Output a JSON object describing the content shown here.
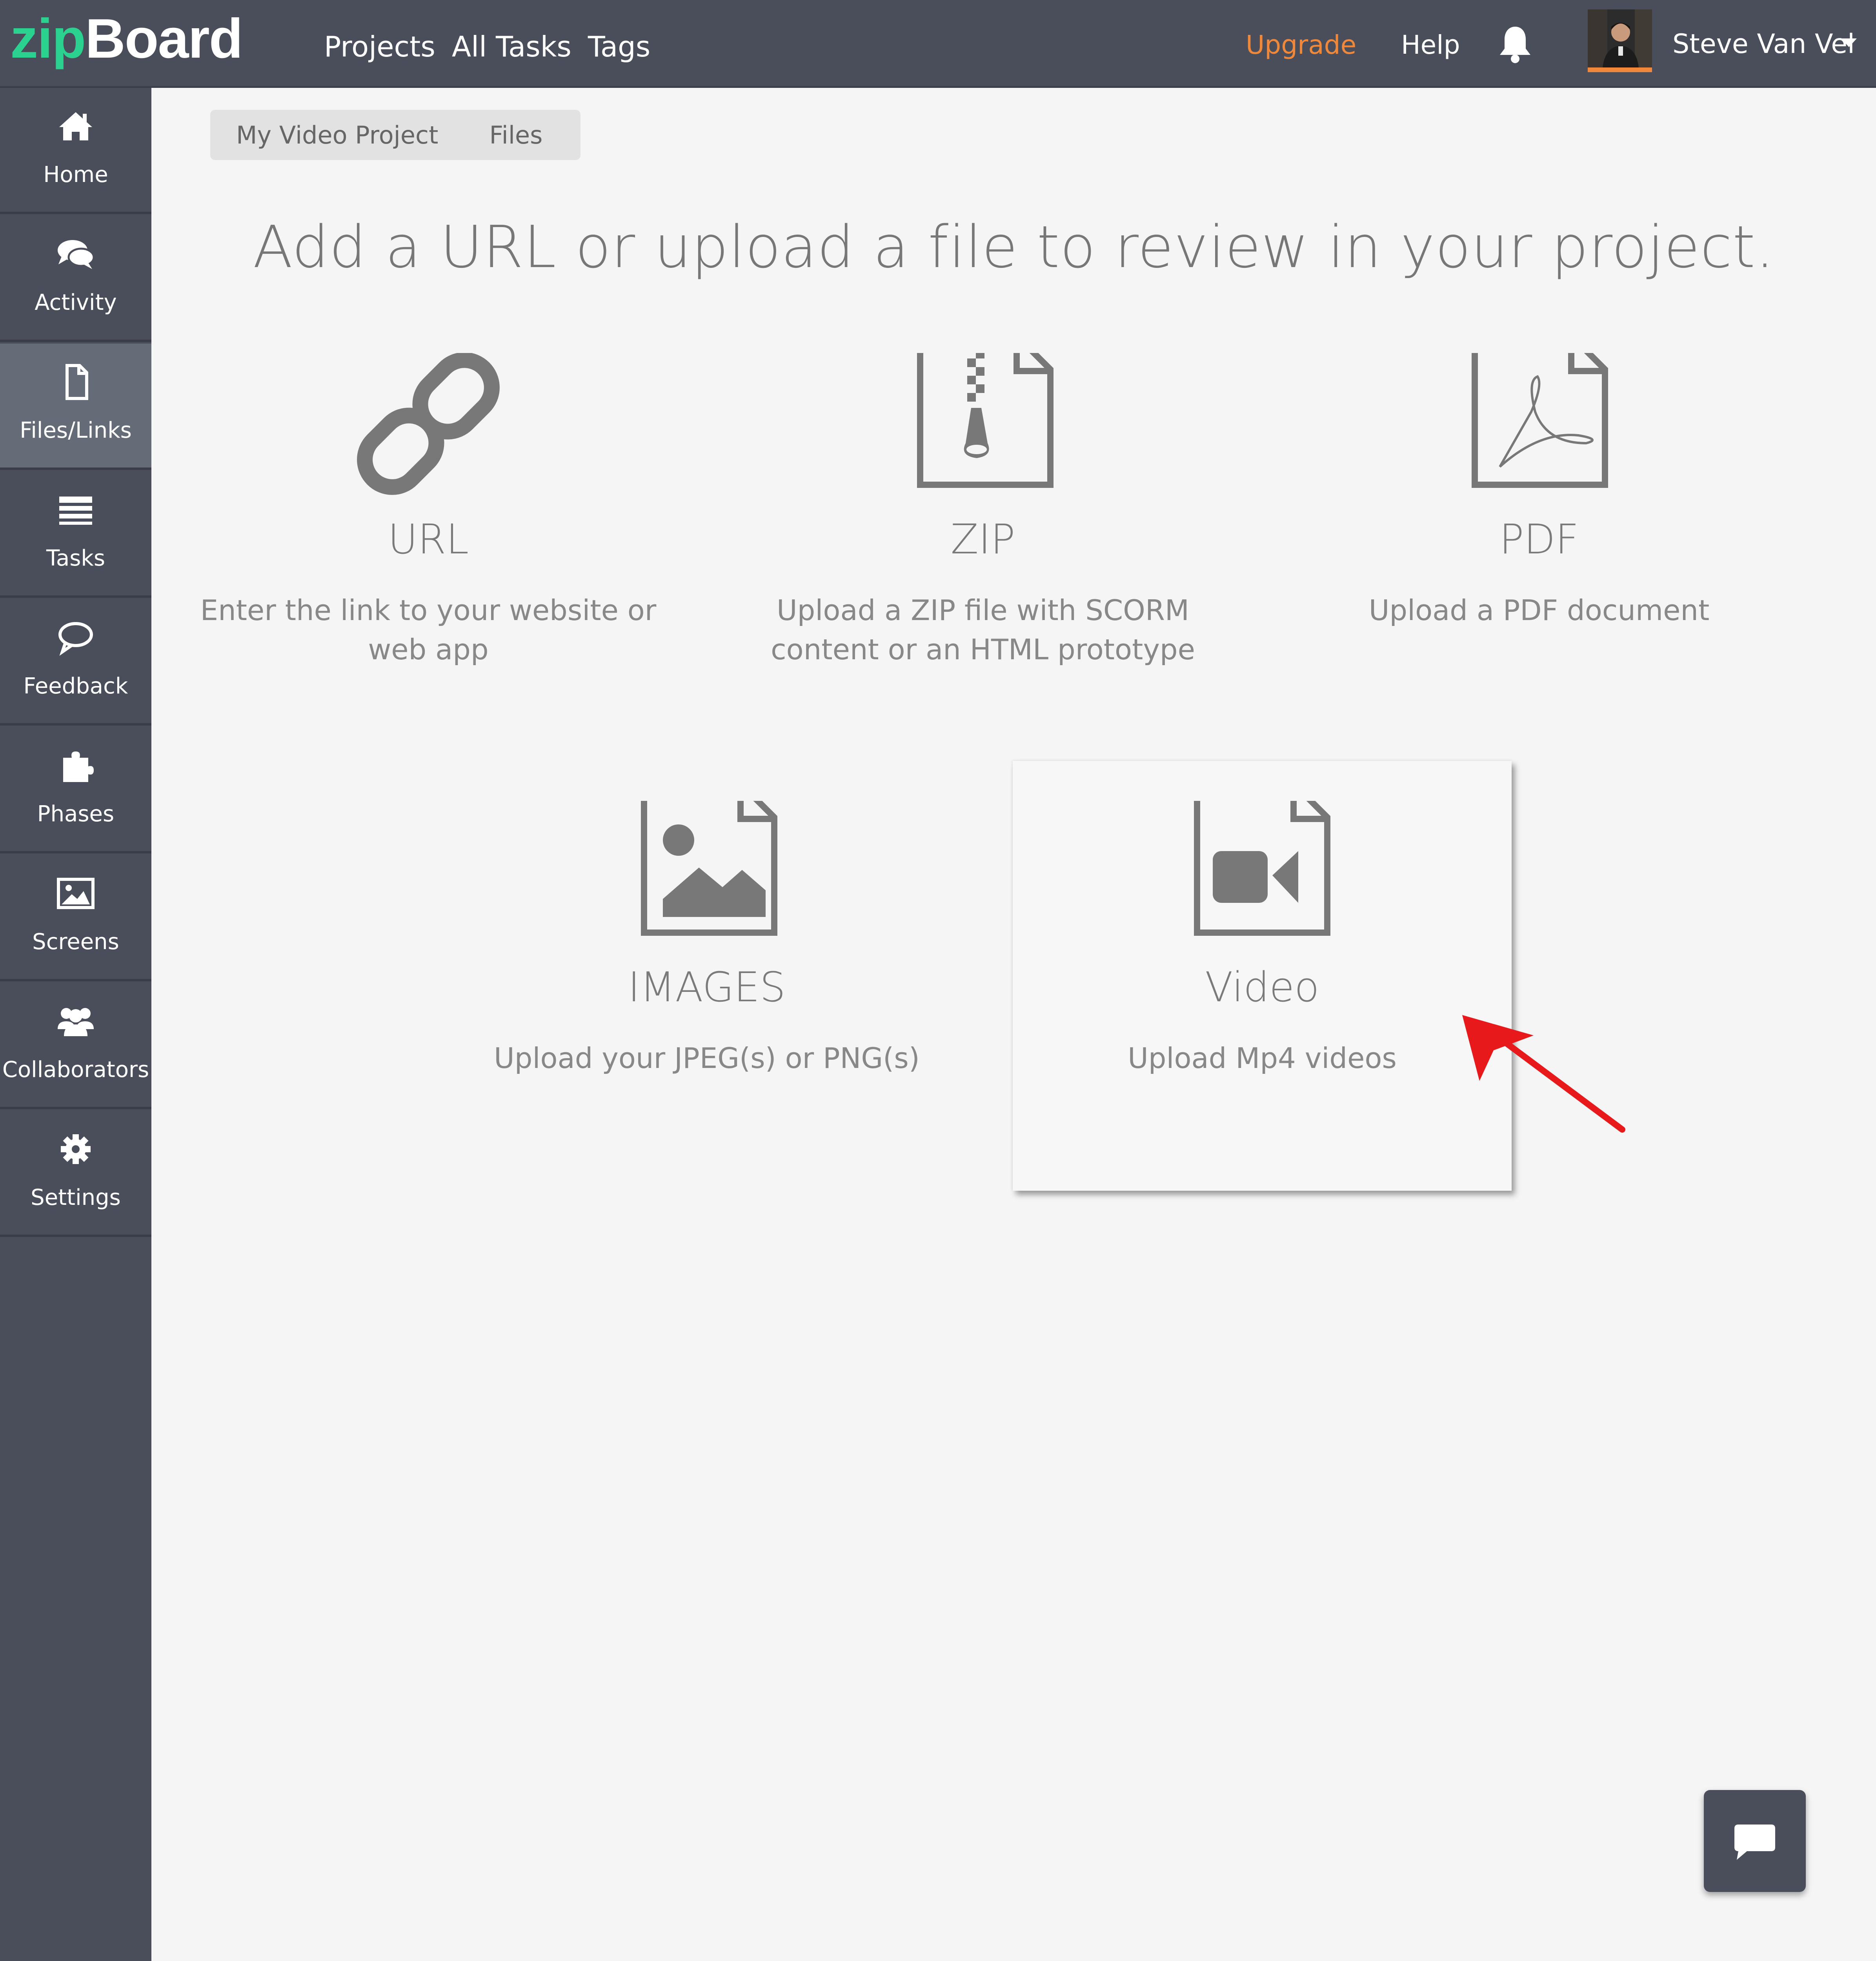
{
  "app": {
    "logo_part1": "zip",
    "logo_part2": "Board"
  },
  "topnav": {
    "items": [
      {
        "label": "Projects"
      },
      {
        "label": "All Tasks"
      },
      {
        "label": "Tags"
      }
    ],
    "upgrade_label": "Upgrade",
    "help_label": "Help",
    "bell_icon": "bell-icon",
    "user_name": "Steve Van Vel"
  },
  "sidebar": {
    "items": [
      {
        "label": "Home",
        "icon": "home-icon",
        "active": false
      },
      {
        "label": "Activity",
        "icon": "chat-bubbles-icon",
        "active": false
      },
      {
        "label": "Files/Links",
        "icon": "file-icon",
        "active": true
      },
      {
        "label": "Tasks",
        "icon": "tasks-list-icon",
        "active": false
      },
      {
        "label": "Feedback",
        "icon": "speech-bubble-icon",
        "active": false
      },
      {
        "label": "Phases",
        "icon": "puzzle-icon",
        "active": false
      },
      {
        "label": "Screens",
        "icon": "picture-icon",
        "active": false
      },
      {
        "label": "Collaborators",
        "icon": "users-icon",
        "active": false
      },
      {
        "label": "Settings",
        "icon": "gear-icon",
        "active": false
      }
    ]
  },
  "breadcrumb": {
    "project": "My Video Project",
    "section": "Files"
  },
  "main": {
    "title": "Add a URL or upload a file to review in your project.",
    "options": {
      "url": {
        "label": "URL",
        "description": "Enter the link to your website or\nweb app",
        "icon": "link-icon"
      },
      "zip": {
        "label": "ZIP",
        "description": "Upload a ZIP file with SCORM\ncontent or an HTML prototype",
        "icon": "zip-file-icon"
      },
      "pdf": {
        "label": "PDF",
        "description": "Upload a PDF document",
        "icon": "pdf-file-icon"
      },
      "images": {
        "label": "IMAGES",
        "description": "Upload your JPEG(s) or PNG(s)",
        "icon": "image-file-icon"
      },
      "video": {
        "label": "Video",
        "description": "Upload Mp4 videos",
        "icon": "video-file-icon"
      }
    }
  },
  "colors": {
    "topbar": "#4a4e5a",
    "accent_green": "#2bd18f",
    "upgrade_orange": "#f0883c",
    "icon_gray": "#787878",
    "arrow_red": "#e8191a"
  }
}
